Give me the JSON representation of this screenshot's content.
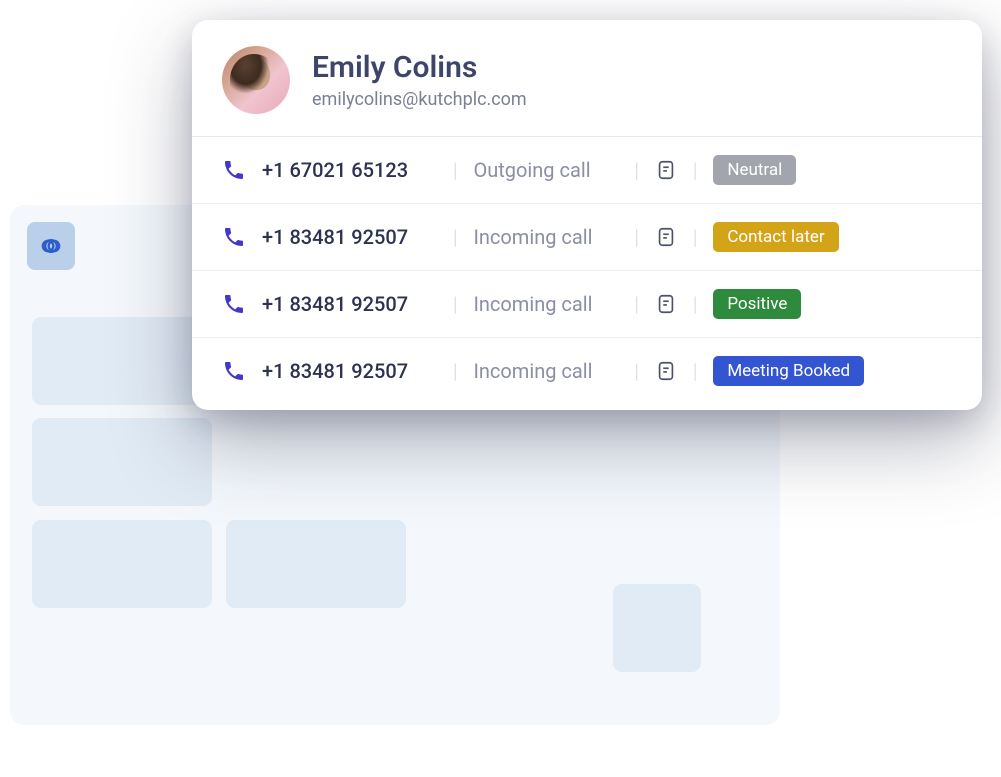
{
  "contact": {
    "name": "Emily Colins",
    "email": "emilycolins@kutchplc.com"
  },
  "calls": [
    {
      "phone": "+1 67021 65123",
      "direction": "Outgoing call",
      "status_label": "Neutral",
      "status_class": "neutral"
    },
    {
      "phone": "+1 83481 92507",
      "direction": "Incoming call",
      "status_label": "Contact later",
      "status_class": "contact-later"
    },
    {
      "phone": "+1 83481 92507",
      "direction": "Incoming call",
      "status_label": "Positive",
      "status_class": "positive"
    },
    {
      "phone": "+1 83481 92507",
      "direction": "Incoming call",
      "status_label": "Meeting Booked",
      "status_class": "meeting-booked"
    }
  ],
  "colors": {
    "accent": "#4338ca",
    "neutral": "#a2a5ad",
    "contact_later": "#d3a418",
    "positive": "#2e8a3d",
    "meeting_booked": "#3455d1"
  }
}
